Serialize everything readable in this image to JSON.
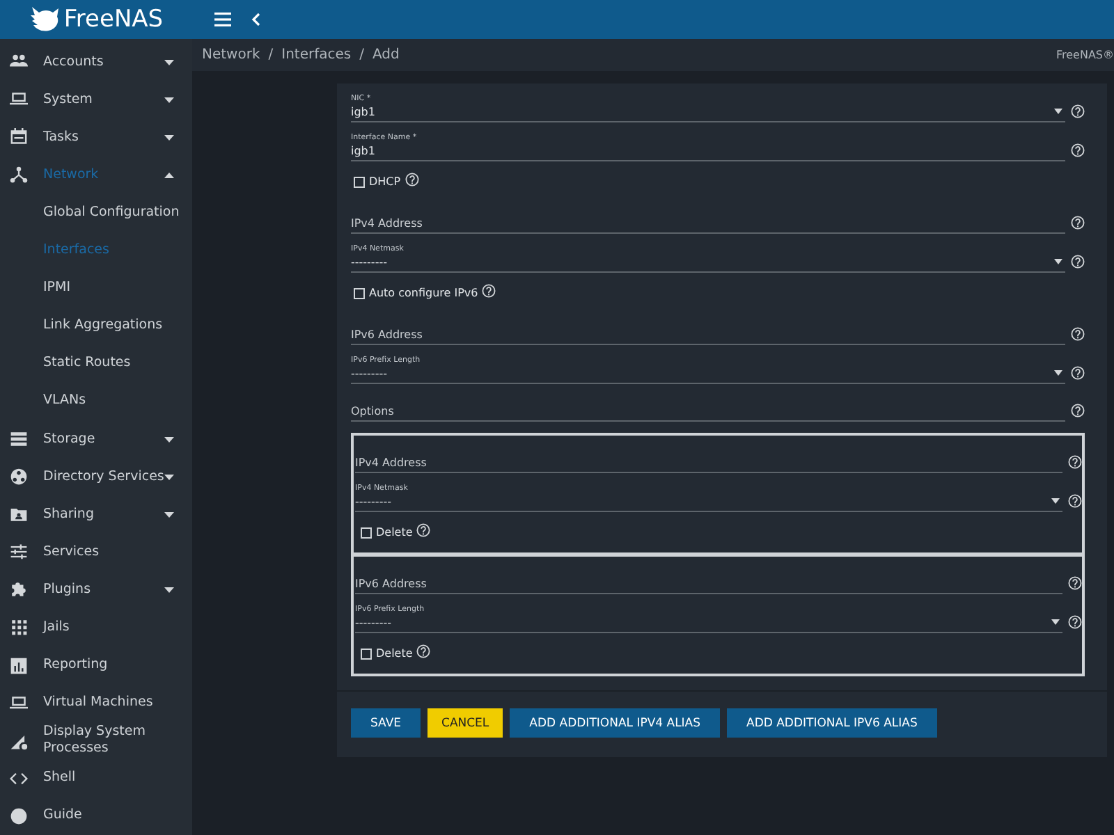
{
  "topbar": {
    "logo": "FreeNAS"
  },
  "breadcrumb": {
    "items": [
      "Network",
      "Interfaces",
      "Add"
    ],
    "separator": "/",
    "product": "FreeNAS®"
  },
  "sidebar": {
    "items": [
      {
        "label": "Accounts",
        "selected": false,
        "expanded": false
      },
      {
        "label": "System",
        "selected": false,
        "expanded": false
      },
      {
        "label": "Tasks",
        "selected": false,
        "expanded": false
      },
      {
        "label": "Network",
        "selected": true,
        "expanded": true,
        "children": [
          {
            "label": "Global Configuration",
            "selected": false
          },
          {
            "label": "Interfaces",
            "selected": true
          },
          {
            "label": "IPMI",
            "selected": false
          },
          {
            "label": "Link Aggregations",
            "selected": false
          },
          {
            "label": "Static Routes",
            "selected": false
          },
          {
            "label": "VLANs",
            "selected": false
          }
        ]
      },
      {
        "label": "Storage",
        "selected": false,
        "expanded": false
      },
      {
        "label": "Directory Services",
        "selected": false,
        "expanded": false
      },
      {
        "label": "Sharing",
        "selected": false,
        "expanded": false
      },
      {
        "label": "Services",
        "selected": false
      },
      {
        "label": "Plugins",
        "selected": false,
        "expanded": false
      },
      {
        "label": "Jails",
        "selected": false
      },
      {
        "label": "Reporting",
        "selected": false
      },
      {
        "label": "Virtual Machines",
        "selected": false
      },
      {
        "label": "Display System Processes",
        "selected": false
      },
      {
        "label": "Shell",
        "selected": false
      },
      {
        "label": "Guide",
        "selected": false
      }
    ]
  },
  "form": {
    "fields": [
      {
        "kind": "select",
        "label": "NIC *",
        "value": "igb1"
      },
      {
        "kind": "input",
        "label": "Interface Name *",
        "value": "igb1"
      },
      {
        "kind": "checkbox",
        "label": "DHCP",
        "checked": false
      },
      {
        "kind": "input",
        "placeholder": "IPv4 Address"
      },
      {
        "kind": "select",
        "label": "IPv4 Netmask",
        "value": "---------"
      },
      {
        "kind": "checkbox",
        "label": "Auto configure IPv6",
        "checked": false
      },
      {
        "kind": "input",
        "placeholder": "IPv6 Address"
      },
      {
        "kind": "select",
        "label": "IPv6 Prefix Length",
        "value": "---------"
      },
      {
        "kind": "input",
        "placeholder": "Options"
      }
    ],
    "aliases": [
      {
        "fields": [
          {
            "kind": "input",
            "placeholder": "IPv4 Address"
          },
          {
            "kind": "select",
            "label": "IPv4 Netmask",
            "value": "---------"
          },
          {
            "kind": "checkbox",
            "label": "Delete",
            "checked": false
          }
        ]
      },
      {
        "fields": [
          {
            "kind": "input",
            "placeholder": "IPv6 Address"
          },
          {
            "kind": "select",
            "label": "IPv6 Prefix Length",
            "value": "---------"
          },
          {
            "kind": "checkbox",
            "label": "Delete",
            "checked": false
          }
        ]
      }
    ],
    "buttons": [
      {
        "label": "SAVE",
        "kind": "primary"
      },
      {
        "label": "CANCEL",
        "kind": "warning"
      },
      {
        "label": "ADD ADDITIONAL IPV4 ALIAS",
        "kind": "primary"
      },
      {
        "label": "ADD ADDITIONAL IPV6 ALIAS",
        "kind": "primary"
      }
    ]
  }
}
